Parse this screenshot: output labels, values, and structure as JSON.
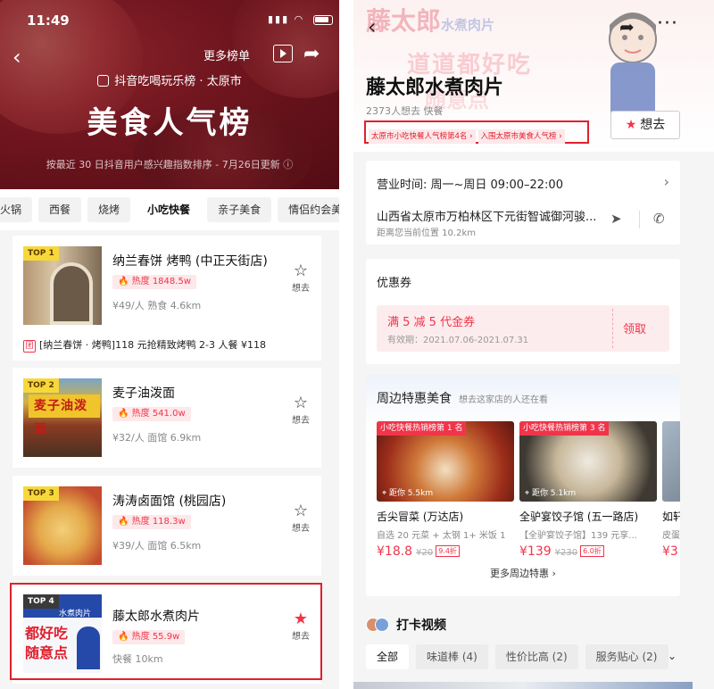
{
  "left": {
    "status": {
      "time": "11:49"
    },
    "header": {
      "more_lists": "更多榜单",
      "brand_line": "抖音吃喝玩乐榜 · 太原市",
      "title": "美食人气榜",
      "subnote": "按最近 30 日抖音用户感兴趣指数排序 - 7月26日更新 ⓘ"
    },
    "categories": [
      "火锅",
      "西餐",
      "烧烤",
      "小吃快餐",
      "亲子美食",
      "情侣约会美"
    ],
    "active_category": "小吃快餐",
    "want_label": "想去",
    "items": [
      {
        "rank": "TOP 1",
        "name": "纳兰春饼 烤鸭 (中正天街店)",
        "heat": "热度 1848.5w",
        "meta": "¥49/人   熟食   4.6km",
        "deal": "[纳兰春饼 · 烤鸭]118 元抢精致烤鸭 2-3 人餐  ¥118",
        "deal_tag": "团"
      },
      {
        "rank": "TOP 2",
        "name": "麦子油泼面",
        "heat": "热度 541.0w",
        "meta": "¥32/人   面馆   6.9km",
        "sign": "麦子油泼面"
      },
      {
        "rank": "TOP 3",
        "name": "涛涛卤面馆 (桃园店)",
        "heat": "热度 118.3w",
        "meta": "¥39/人   面馆   6.5km"
      },
      {
        "rank": "TOP 4",
        "name": "藤太郎水煮肉片",
        "heat": "热度 55.9w",
        "meta": "快餐   10km",
        "thumb_brand": "水煮肉片",
        "thumb_line1": "都好吃",
        "thumb_line2": "随意点"
      }
    ]
  },
  "right": {
    "watermark": {
      "brand": "藤太郎",
      "brand_sub": "水煮肉片",
      "slogan": "道道都好吃",
      "slogan2": "随意点"
    },
    "shop": {
      "name": "藤太郎水煮肉片",
      "sub": "2373人想去   快餐",
      "ranks": [
        "太原市小吃快餐人气榜第4名 ›",
        "入围太原市美食人气榜 ›"
      ],
      "want_button": "想去"
    },
    "info": {
      "hours": "营业时间: 周一~周日 09:00–22:00",
      "address": "山西省太原市万柏林区下元街智诚御河骏...",
      "distance": "距离您当前位置 10.2km"
    },
    "coupon": {
      "title": "优惠券",
      "name": "满 5 减 5 代金券",
      "validity": "有效期：2021.07.06-2021.07.31",
      "button": "领取"
    },
    "nearby": {
      "title": "周边特惠美食",
      "subtitle": "想去这家店的人还在看",
      "items": [
        {
          "tag": "小吃快餐热销榜第 1 名",
          "distance": "距你 5.5km",
          "name": "舌尖冒菜 (万达店)",
          "desc": "自选 20 元菜 + 太钢 1+ 米饭 1",
          "price": "¥18.8",
          "old": "¥20",
          "discount": "9.4折"
        },
        {
          "tag": "小吃快餐热销榜第 3 名",
          "distance": "距你 5.1km",
          "name": "全驴宴饺子馆 (五一路店)",
          "desc": "【全驴宴饺子馆】139 元享...",
          "price": "¥139",
          "old": "¥230",
          "discount": "6.0折"
        },
        {
          "tag": "",
          "distance": "",
          "name": "如轩",
          "desc": "皮蛋",
          "price": "¥3",
          "old": "",
          "discount": ""
        }
      ],
      "more": "更多周边特惠 ›"
    },
    "checkin": {
      "title": "打卡视频"
    },
    "filters": [
      "全部",
      "味道棒 (4)",
      "性价比高 (2)",
      "服务贴心 (2)"
    ],
    "active_filter": "全部"
  },
  "colors": {
    "accent": "#f0354a",
    "highlight": "#e0202e",
    "top_tag": "#f7d83a",
    "hero": "#8e1f2a"
  }
}
